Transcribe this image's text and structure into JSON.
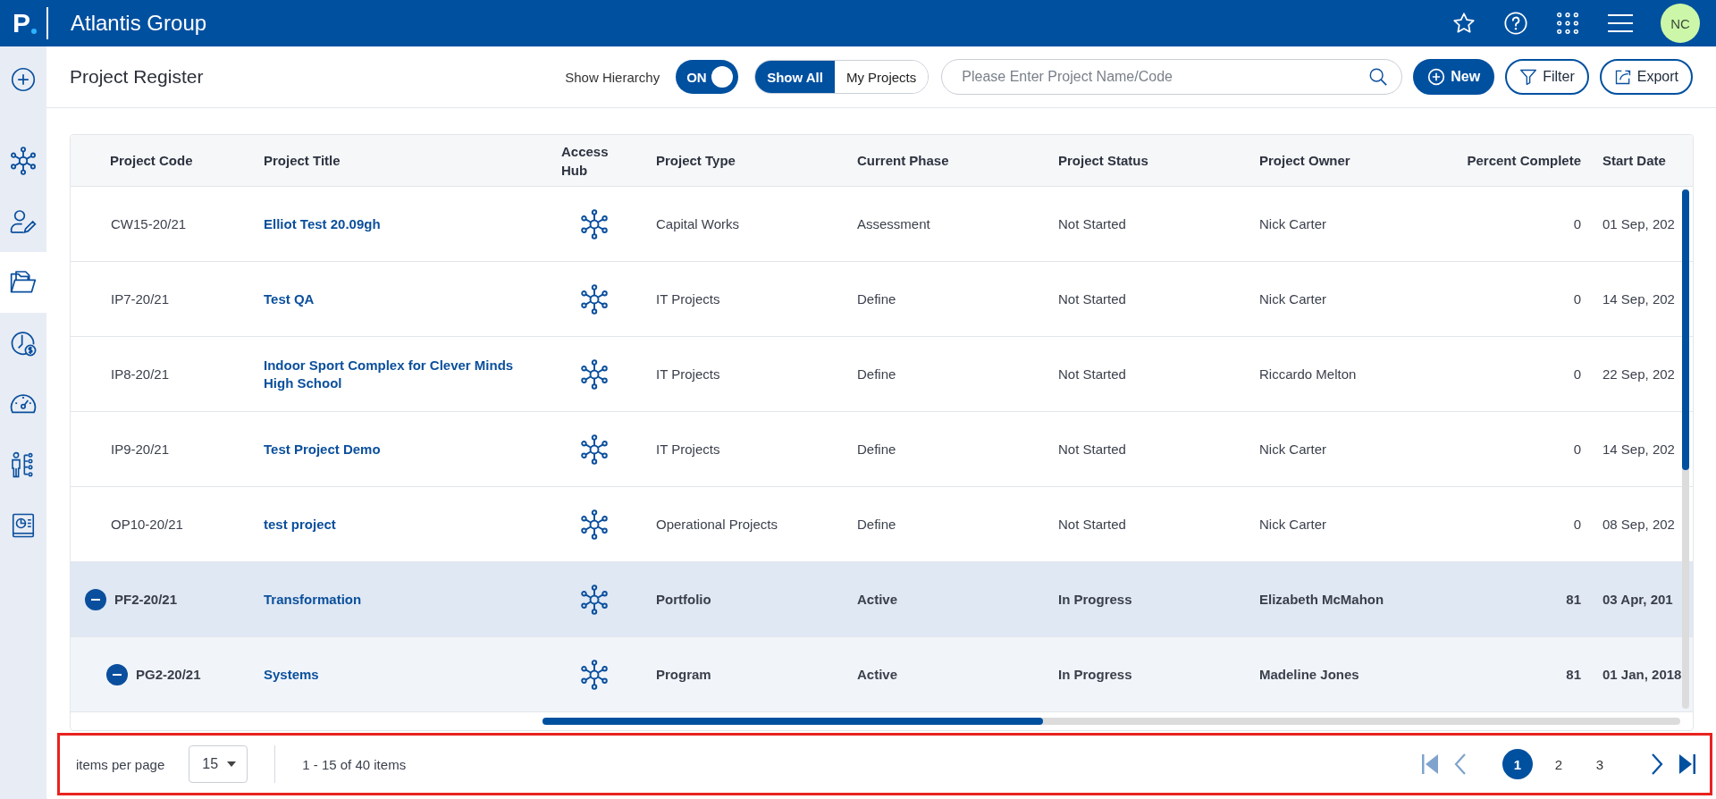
{
  "header": {
    "logo": "P",
    "title": "Atlantis Group",
    "avatar": "NC"
  },
  "sidebar": {
    "items": [
      {
        "kind": "add",
        "selected": false
      },
      {
        "kind": "hub",
        "selected": false
      },
      {
        "kind": "user-edit",
        "selected": false
      },
      {
        "kind": "folder",
        "selected": true
      },
      {
        "kind": "clock-dollar",
        "selected": false
      },
      {
        "kind": "gauge",
        "selected": false
      },
      {
        "kind": "org-chart",
        "selected": false
      },
      {
        "kind": "report",
        "selected": false
      }
    ]
  },
  "page_title": "Project Register",
  "hierarchy": {
    "label": "Show Hierarchy",
    "toggle_text": "ON",
    "on": true
  },
  "view_filter": [
    {
      "label": "Show All",
      "selected": true
    },
    {
      "label": "My Projects",
      "selected": false
    }
  ],
  "search": {
    "placeholder": "Please Enter Project Name/Code"
  },
  "actions": [
    {
      "label": "New",
      "kind": "new"
    },
    {
      "label": "Filter",
      "kind": "filter"
    },
    {
      "label": "Export",
      "kind": "export"
    }
  ],
  "table": {
    "columns": [
      "Project Code",
      "Project Title",
      "Access Hub",
      "Project Type",
      "Current Phase",
      "Project Status",
      "Project Owner",
      "Percent Complete",
      "Start Date"
    ],
    "rows": [
      {
        "code": "CW15-20/21",
        "title": "Elliot Test 20.09gh",
        "type": "Capital Works",
        "phase": "Assessment",
        "status": "Not Started",
        "owner": "Nick Carter",
        "percent": "0",
        "start_date": "01 Sep, 202"
      },
      {
        "code": "IP7-20/21",
        "title": "Test QA",
        "type": "IT Projects",
        "phase": "Define",
        "status": "Not Started",
        "owner": "Nick Carter",
        "percent": "0",
        "start_date": "14 Sep, 202"
      },
      {
        "code": "IP8-20/21",
        "title": "Indoor Sport Complex for Clever Minds High School",
        "type": "IT Projects",
        "phase": "Define",
        "status": "Not Started",
        "owner": "Riccardo Melton",
        "percent": "0",
        "start_date": "22 Sep, 202"
      },
      {
        "code": "IP9-20/21",
        "title": "Test Project Demo",
        "type": "IT Projects",
        "phase": "Define",
        "status": "Not Started",
        "owner": "Nick Carter",
        "percent": "0",
        "start_date": "14 Sep, 202"
      },
      {
        "code": "OP10-20/21",
        "title": "test project",
        "type": "Operational Projects",
        "phase": "Define",
        "status": "Not Started",
        "owner": "Nick Carter",
        "percent": "0",
        "start_date": "08 Sep, 202"
      },
      {
        "code": "PF2-20/21",
        "title": "Transformation",
        "type": "Portfolio",
        "phase": "Active",
        "status": "In Progress",
        "owner": "Elizabeth McMahon",
        "percent": "81",
        "start_date": "03 Apr, 201",
        "expanded": true,
        "children": [
          {
            "code": "PG2-20/21",
            "title": "Systems",
            "type": "Program",
            "phase": "Active",
            "status": "In Progress",
            "owner": "Madeline Jones",
            "percent": "81",
            "start_date": "01 Jan, 2018",
            "expanded": true
          }
        ]
      }
    ]
  },
  "pagination": {
    "label": "items per page",
    "page_size": "15",
    "summary": "1 - 15 of 40 items",
    "nav": [
      {
        "kind": "first",
        "disabled": true
      },
      {
        "kind": "prev",
        "disabled": true
      },
      {
        "kind": "next",
        "disabled": false
      },
      {
        "kind": "last",
        "disabled": false
      }
    ],
    "pages": [
      {
        "label": "1",
        "selected": true
      },
      {
        "label": "2",
        "selected": false
      },
      {
        "label": "3",
        "selected": false
      }
    ]
  }
}
